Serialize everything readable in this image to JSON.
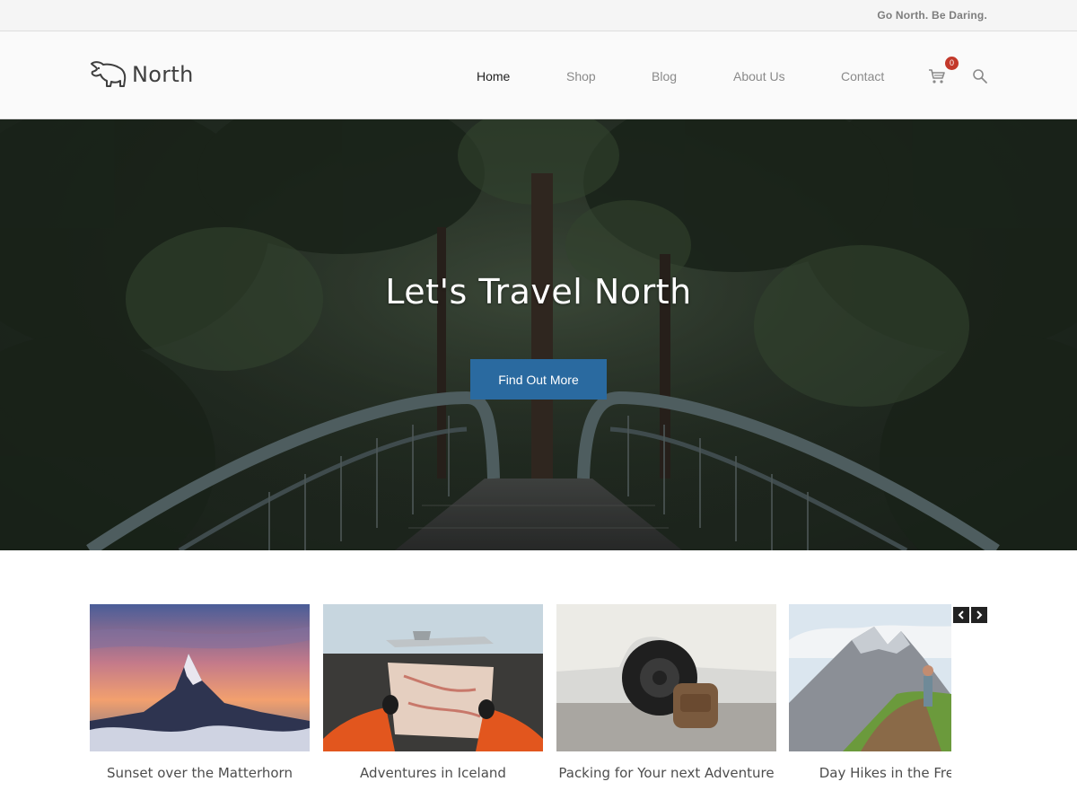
{
  "topbar": {
    "tagline": "Go North. Be Daring."
  },
  "header": {
    "logo_text": "North",
    "nav": [
      {
        "label": "Home",
        "active": true
      },
      {
        "label": "Shop",
        "active": false
      },
      {
        "label": "Blog",
        "active": false
      },
      {
        "label": "About Us",
        "active": false
      },
      {
        "label": "Contact",
        "active": false
      }
    ],
    "cart_count": "0",
    "icons": {
      "logo": "polar-bear-icon",
      "cart": "cart-icon",
      "search": "search-icon"
    }
  },
  "hero": {
    "title": "Let's Travel North",
    "button_label": "Find Out More"
  },
  "carousel": {
    "items": [
      {
        "caption": "Sunset over the Matterhorn"
      },
      {
        "caption": "Adventures in Iceland"
      },
      {
        "caption": "Packing for Your next Adventure"
      },
      {
        "caption": "Day Hikes in the French"
      }
    ],
    "icons": {
      "prev": "chevron-left-icon",
      "next": "chevron-right-icon"
    }
  },
  "colors": {
    "accent": "#2a6aa0",
    "badge": "#c3392b",
    "nav_active": "#222222",
    "nav_inactive": "#8a8a8a"
  }
}
